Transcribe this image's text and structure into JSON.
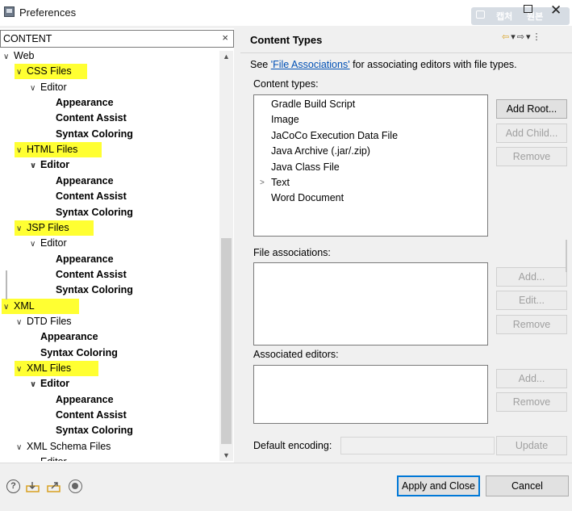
{
  "window": {
    "title": "Preferences",
    "overlay_capture": "캡처",
    "overlay_original": "원본"
  },
  "filter": {
    "value": "CONTENT",
    "clear": "×"
  },
  "tree": {
    "items": [
      {
        "label": "Web",
        "twisty": "∨",
        "bold": false,
        "highlight": false
      },
      {
        "label": "CSS Files",
        "twisty": "∨",
        "bold": false,
        "highlight": true
      },
      {
        "label": "Editor",
        "twisty": "∨",
        "bold": false,
        "highlight": false
      },
      {
        "label": "Appearance",
        "twisty": "",
        "bold": true,
        "highlight": false
      },
      {
        "label": "Content Assist",
        "twisty": "",
        "bold": true,
        "highlight": false
      },
      {
        "label": "Syntax Coloring",
        "twisty": "",
        "bold": true,
        "highlight": false
      },
      {
        "label": "HTML Files",
        "twisty": "∨",
        "bold": false,
        "highlight": true
      },
      {
        "label": "Editor",
        "twisty": "∨",
        "bold": true,
        "highlight": false
      },
      {
        "label": "Appearance",
        "twisty": "",
        "bold": true,
        "highlight": false
      },
      {
        "label": "Content Assist",
        "twisty": "",
        "bold": true,
        "highlight": false
      },
      {
        "label": "Syntax Coloring",
        "twisty": "",
        "bold": true,
        "highlight": false
      },
      {
        "label": "JSP Files",
        "twisty": "∨",
        "bold": false,
        "highlight": true
      },
      {
        "label": "Editor",
        "twisty": "∨",
        "bold": false,
        "highlight": false
      },
      {
        "label": "Appearance",
        "twisty": "",
        "bold": true,
        "highlight": false
      },
      {
        "label": "Content Assist",
        "twisty": "",
        "bold": true,
        "highlight": false
      },
      {
        "label": "Syntax Coloring",
        "twisty": "",
        "bold": true,
        "highlight": false
      },
      {
        "label": "XML",
        "twisty": "∨",
        "bold": false,
        "highlight": true
      },
      {
        "label": "DTD Files",
        "twisty": "∨",
        "bold": false,
        "highlight": false
      },
      {
        "label": "Appearance",
        "twisty": "",
        "bold": true,
        "highlight": false
      },
      {
        "label": "Syntax Coloring",
        "twisty": "",
        "bold": true,
        "highlight": false
      },
      {
        "label": "XML Files",
        "twisty": "∨",
        "bold": false,
        "highlight": true
      },
      {
        "label": "Editor",
        "twisty": "∨",
        "bold": true,
        "highlight": false
      },
      {
        "label": "Appearance",
        "twisty": "",
        "bold": true,
        "highlight": false
      },
      {
        "label": "Content Assist",
        "twisty": "",
        "bold": true,
        "highlight": false
      },
      {
        "label": "Syntax Coloring",
        "twisty": "",
        "bold": true,
        "highlight": false
      },
      {
        "label": "XML Schema Files",
        "twisty": "∨",
        "bold": false,
        "highlight": false
      },
      {
        "label": "Editor",
        "twisty": "",
        "bold": false,
        "highlight": false
      }
    ]
  },
  "page": {
    "title": "Content Types",
    "desc_before": "See ",
    "desc_link": "'File Associations'",
    "desc_after": " for associating editors with file types.",
    "content_types_label": "Content types:",
    "content_types": [
      {
        "label": "Gradle Build Script",
        "twisty": ""
      },
      {
        "label": "Image",
        "twisty": ""
      },
      {
        "label": "JaCoCo Execution Data File",
        "twisty": ""
      },
      {
        "label": "Java Archive (.jar/.zip)",
        "twisty": ""
      },
      {
        "label": "Java Class File",
        "twisty": ""
      },
      {
        "label": "Text",
        "twisty": ">"
      },
      {
        "label": "Word Document",
        "twisty": ""
      }
    ],
    "add_root": "Add Root...",
    "add_child": "Add Child...",
    "remove": "Remove",
    "file_assoc_label": "File associations:",
    "add": "Add...",
    "edit": "Edit...",
    "assoc_editors_label": "Associated editors:",
    "default_encoding_label": "Default encoding:",
    "default_encoding_value": "",
    "update": "Update"
  },
  "footer": {
    "help": "?",
    "apply_close": "Apply and Close",
    "cancel": "Cancel"
  }
}
